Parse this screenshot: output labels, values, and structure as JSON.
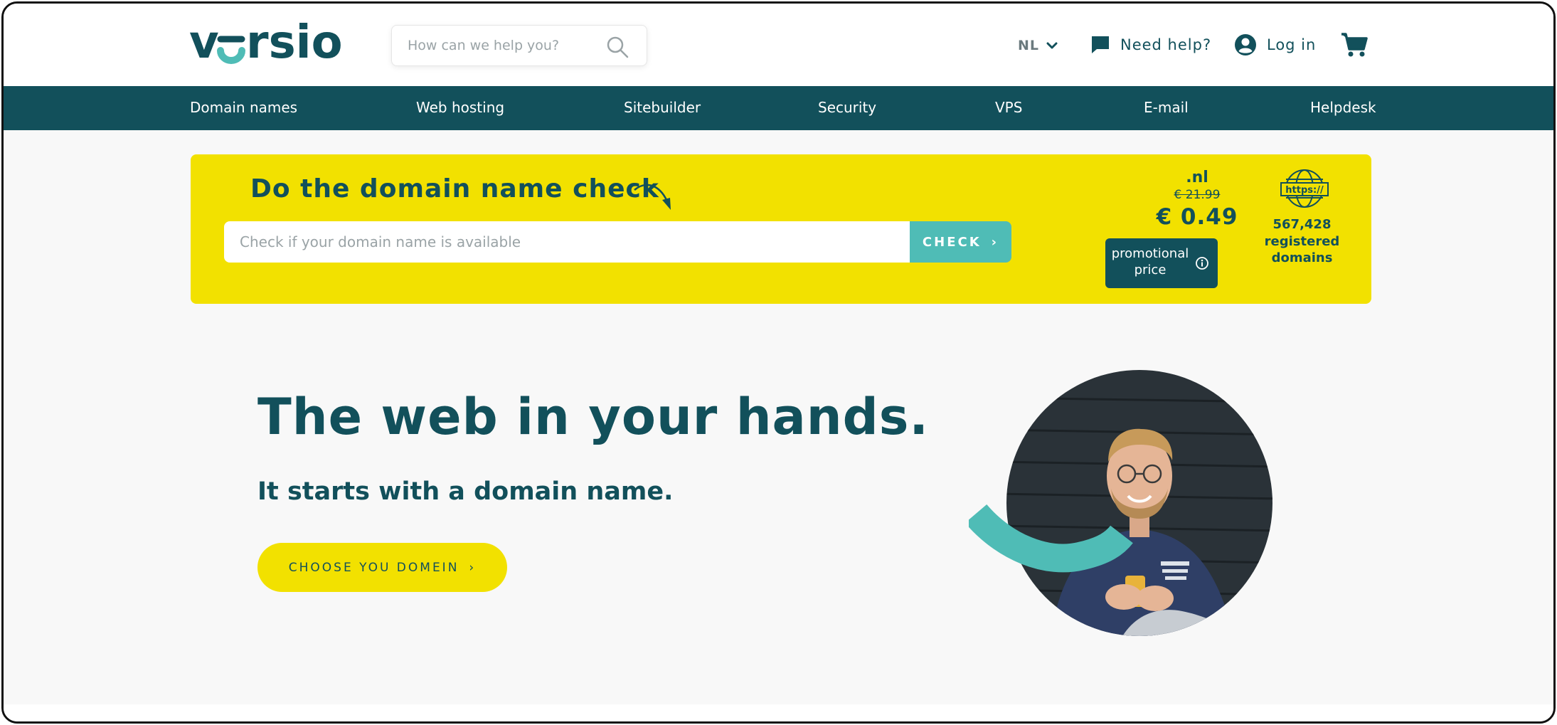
{
  "brand": {
    "name": "versio",
    "primary": "#12505b",
    "accent": "#4fbcb6",
    "yellow": "#f2e100"
  },
  "header": {
    "search_placeholder": "How can we help you?",
    "search_icon": "search-icon",
    "language": "NL",
    "help_label": "Need help?",
    "login_label": "Log in",
    "cart_icon": "cart-icon"
  },
  "nav": {
    "items": [
      {
        "label": "Domain names"
      },
      {
        "label": "Web hosting"
      },
      {
        "label": "Sitebuilder"
      },
      {
        "label": "Security"
      },
      {
        "label": "VPS"
      },
      {
        "label": "E-mail"
      },
      {
        "label": "Helpdesk"
      }
    ]
  },
  "promo": {
    "title": "Do the domain name check",
    "input_placeholder": "Check if your domain name is available",
    "check_label": "CHECK",
    "check_chevron": "›",
    "tld": ".nl",
    "old_price": "€ 21.99",
    "new_price": "€ 0.49",
    "badge_label": "promotional price",
    "globe_text": "https://",
    "registered_count": "567,428",
    "registered_label": "registered domains"
  },
  "hero": {
    "title": "The web in your hands.",
    "subtitle": "It starts with a domain name.",
    "cta_label": "CHOOSE YOU DOMEIN",
    "cta_chevron": "›"
  }
}
